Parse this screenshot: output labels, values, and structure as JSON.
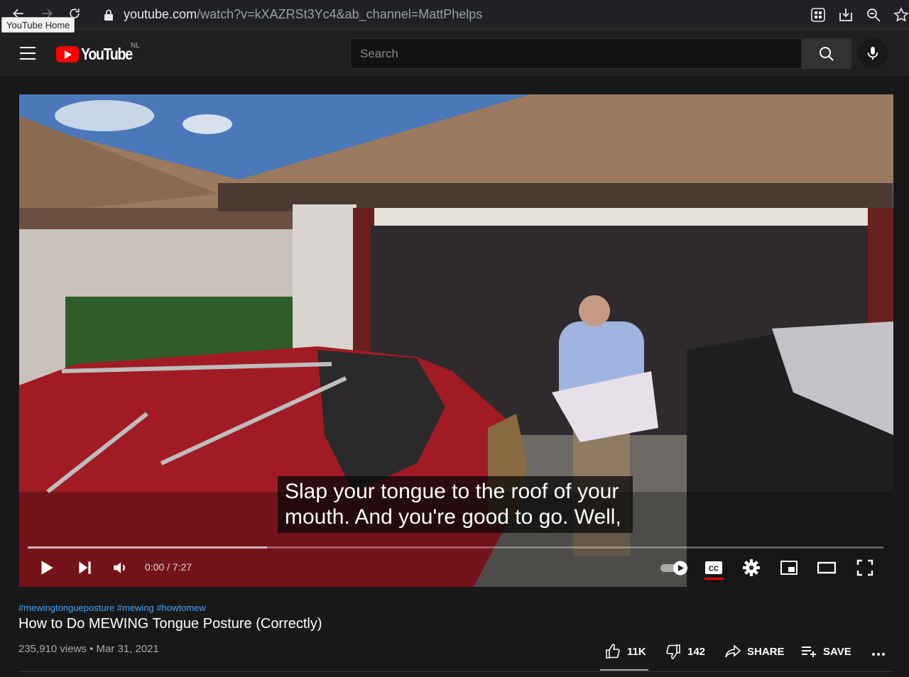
{
  "browser": {
    "url_host": "youtube.com",
    "url_path": "/watch?v=kXAZRSt3Yc4&ab_channel=MattPhelps",
    "tooltip": "YouTube Home"
  },
  "header": {
    "logo_text": "YouTube",
    "country_code": "NL",
    "search_placeholder": "Search"
  },
  "player": {
    "subtitle": "Slap your tongue to the roof of your mouth. And you're good to go. Well,",
    "current_time": "0:00",
    "duration": "7:27",
    "time_display": "0:00 / 7:27",
    "progress_fraction": 0.28
  },
  "video": {
    "hashtags": "#mewingtongueposture #mewing #howtomew",
    "title": "How to Do MEWING Tongue Posture (Correctly)",
    "views": "235,910 views",
    "date": "Mar 31, 2021",
    "meta": "235,910 views • Mar 31, 2021"
  },
  "actions": {
    "likes": "11K",
    "dislikes": "142",
    "share": "SHARE",
    "save": "SAVE"
  }
}
